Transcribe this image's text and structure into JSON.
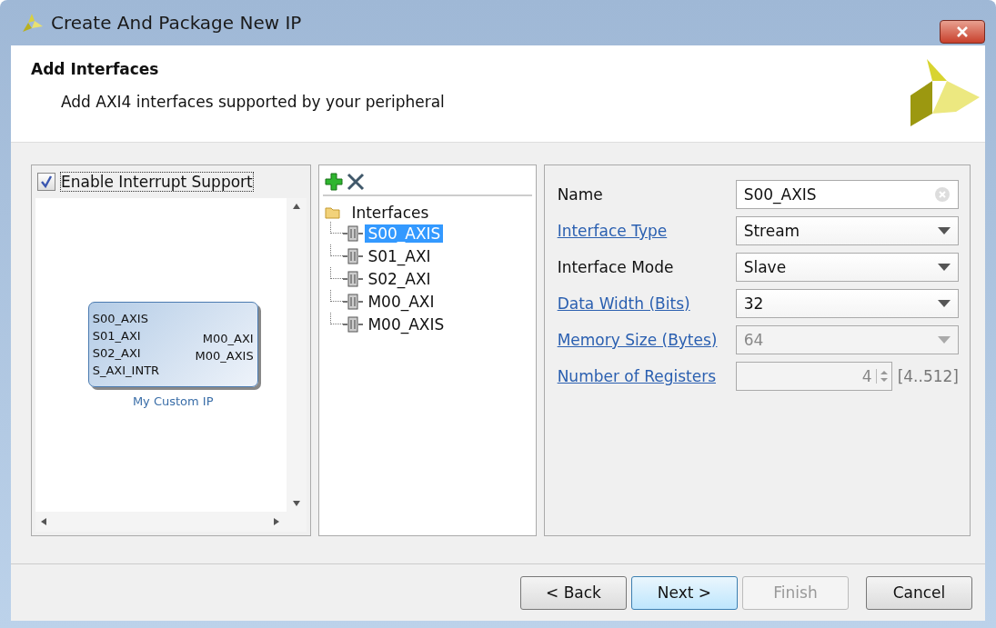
{
  "window": {
    "title": "Create And Package New IP"
  },
  "header": {
    "title": "Add Interfaces",
    "subtitle": "Add AXI4 interfaces supported by your peripheral"
  },
  "interrupt": {
    "label": "Enable Interrupt Support",
    "checked": true
  },
  "block": {
    "caption": "My Custom IP",
    "left_ports": [
      "S00_AXIS",
      "S01_AXI",
      "S02_AXI",
      "S_AXI_INTR"
    ],
    "right_ports": [
      "M00_AXI",
      "M00_AXIS"
    ]
  },
  "tree": {
    "label": "Interfaces",
    "children": [
      {
        "label": "S00_AXIS",
        "selected": true
      },
      {
        "label": "S01_AXI",
        "selected": false
      },
      {
        "label": "S02_AXI",
        "selected": false
      },
      {
        "label": "M00_AXI",
        "selected": false
      },
      {
        "label": "M00_AXIS",
        "selected": false
      }
    ]
  },
  "fields": [
    {
      "kind": "text",
      "label": "Name",
      "link": false,
      "value": "S00_AXIS",
      "disabled": false
    },
    {
      "kind": "select",
      "label": "Interface Type",
      "link": true,
      "value": "Stream",
      "disabled": false
    },
    {
      "kind": "select",
      "label": "Interface Mode",
      "link": false,
      "value": "Slave",
      "disabled": false
    },
    {
      "kind": "select",
      "label": "Data Width (Bits)",
      "link": true,
      "value": "32",
      "disabled": false
    },
    {
      "kind": "select",
      "label": "Memory Size (Bytes)",
      "link": true,
      "value": "64",
      "disabled": true
    },
    {
      "kind": "spinner",
      "label": "Number of Registers",
      "link": true,
      "value": "4",
      "range": "[4..512]",
      "disabled": true
    }
  ],
  "buttons": [
    {
      "label": "< Back",
      "default": false,
      "disabled": false
    },
    {
      "label": "Next >",
      "default": true,
      "disabled": false
    },
    {
      "label": "Finish",
      "default": false,
      "disabled": true
    },
    {
      "label": "Cancel",
      "default": false,
      "disabled": false
    }
  ]
}
